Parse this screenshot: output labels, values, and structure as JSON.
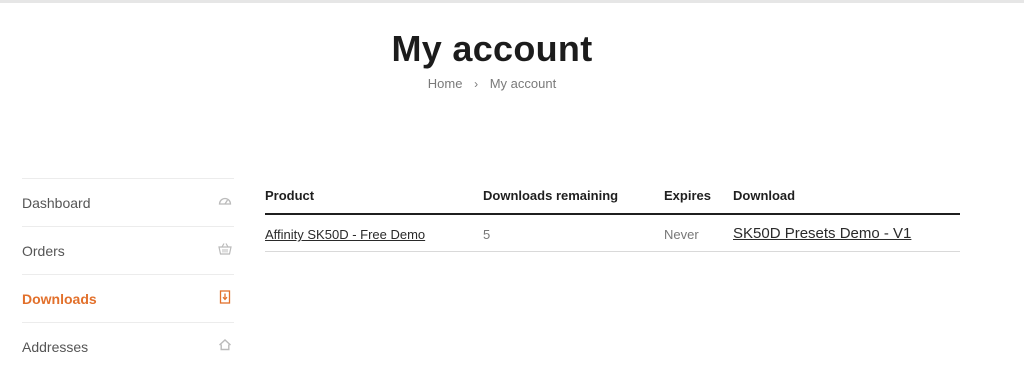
{
  "header": {
    "title": "My account"
  },
  "breadcrumb": {
    "home": "Home",
    "separator": "›",
    "current": "My account"
  },
  "sidebar": {
    "accent_color": "#e2702b",
    "items": [
      {
        "label": "Dashboard",
        "icon": "dashboard-gauge-icon",
        "active": false
      },
      {
        "label": "Orders",
        "icon": "basket-icon",
        "active": false
      },
      {
        "label": "Downloads",
        "icon": "file-download-icon",
        "active": true
      },
      {
        "label": "Addresses",
        "icon": "home-icon",
        "active": false
      }
    ]
  },
  "downloads_table": {
    "columns": [
      "Product",
      "Downloads remaining",
      "Expires",
      "Download"
    ],
    "rows": [
      {
        "product": "Affinity SK50D - Free Demo",
        "remaining": "5",
        "expires": "Never",
        "download": "SK50D Presets Demo - V1"
      }
    ]
  }
}
